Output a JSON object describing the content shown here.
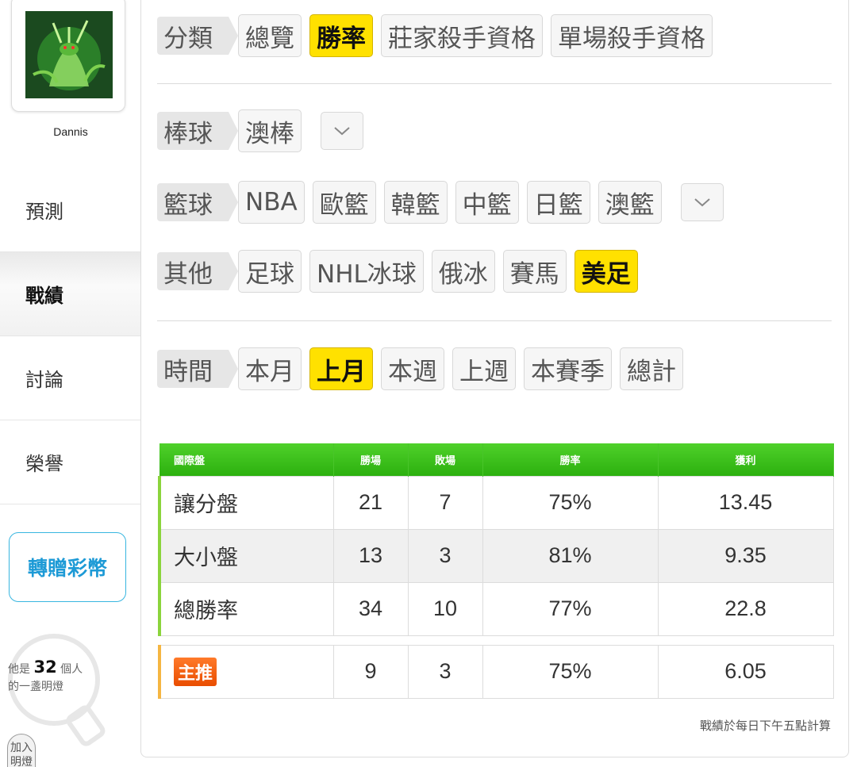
{
  "user": {
    "name": "Dannis"
  },
  "nav": {
    "predict": "預測",
    "record": "戰績",
    "discuss": "討論",
    "honor": "榮譽"
  },
  "gift_button": "轉贈彩幣",
  "lamp": {
    "prefix": "他是",
    "count": "32",
    "suffix": "個人",
    "line2": "的一盞明燈"
  },
  "join_button": "加入明燈",
  "filters": {
    "category": {
      "label": "分類",
      "options": [
        "總覽",
        "勝率",
        "莊家殺手資格",
        "單場殺手資格"
      ],
      "selected": "勝率"
    },
    "baseball": {
      "label": "棒球",
      "options": [
        "澳棒"
      ]
    },
    "basketball": {
      "label": "籃球",
      "options": [
        "NBA",
        "歐籃",
        "韓籃",
        "中籃",
        "日籃",
        "澳籃"
      ]
    },
    "other": {
      "label": "其他",
      "options": [
        "足球",
        "NHL冰球",
        "俄冰",
        "賽馬",
        "美足"
      ],
      "selected": "美足"
    },
    "time": {
      "label": "時間",
      "options": [
        "本月",
        "上月",
        "本週",
        "上週",
        "本賽季",
        "總計"
      ],
      "selected": "上月"
    }
  },
  "table": {
    "headers": [
      "國際盤",
      "勝場",
      "敗場",
      "勝率",
      "獲利"
    ],
    "rows": [
      [
        "讓分盤",
        "21",
        "7",
        "75%",
        "13.45"
      ],
      [
        "大小盤",
        "13",
        "3",
        "81%",
        "9.35"
      ],
      [
        "總勝率",
        "34",
        "10",
        "77%",
        "22.8"
      ]
    ],
    "featured": {
      "badge": "主推",
      "wins": "9",
      "losses": "3",
      "rate": "75%",
      "profit": "6.05"
    }
  },
  "footnote": "戰績於每日下午五點計算",
  "colors": {
    "selected_chip": "#ffe100",
    "table_header": "#36bd14",
    "accent_blue": "#1d9ad6",
    "badge": "#f26a12"
  }
}
